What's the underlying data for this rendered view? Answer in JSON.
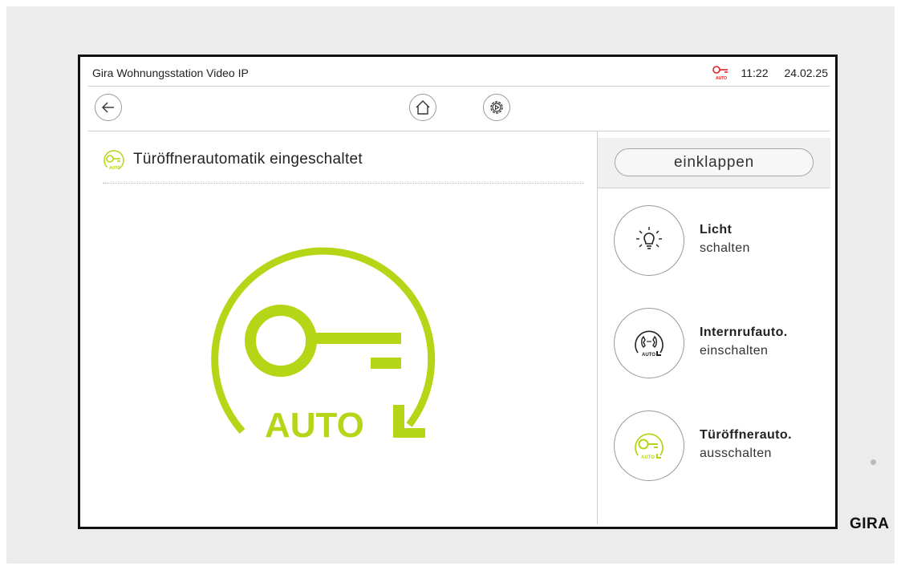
{
  "status_bar": {
    "app_title": "Gira Wohnungsstation Video IP",
    "key_badge": "AUTO",
    "time": "11:22",
    "date": "24.02.25"
  },
  "nav": {
    "back_icon": "arrow-left-icon",
    "home_icon": "home-icon",
    "settings_icon": "gear-play-icon"
  },
  "main": {
    "heading_icon": "key-auto-icon",
    "heading": "Türöffnerautomatik eingeschaltet",
    "graphic_label": "AUTO"
  },
  "panel": {
    "collapse_label": "einklappen",
    "actions": [
      {
        "icon": "light-bulb-icon",
        "title": "Licht",
        "subtitle": "schalten"
      },
      {
        "icon": "intercom-auto-icon",
        "title": "Internrufauto.",
        "subtitle": "einschalten",
        "badge": "AUTO"
      },
      {
        "icon": "key-auto-icon",
        "title": "Türöffnerauto.",
        "subtitle": "ausschalten",
        "badge": "AUTO"
      }
    ]
  },
  "brand": "GIRA",
  "colors": {
    "accent": "#b5d616",
    "alert": "#e31e24",
    "frame": "#111111",
    "device": "#ececec"
  }
}
